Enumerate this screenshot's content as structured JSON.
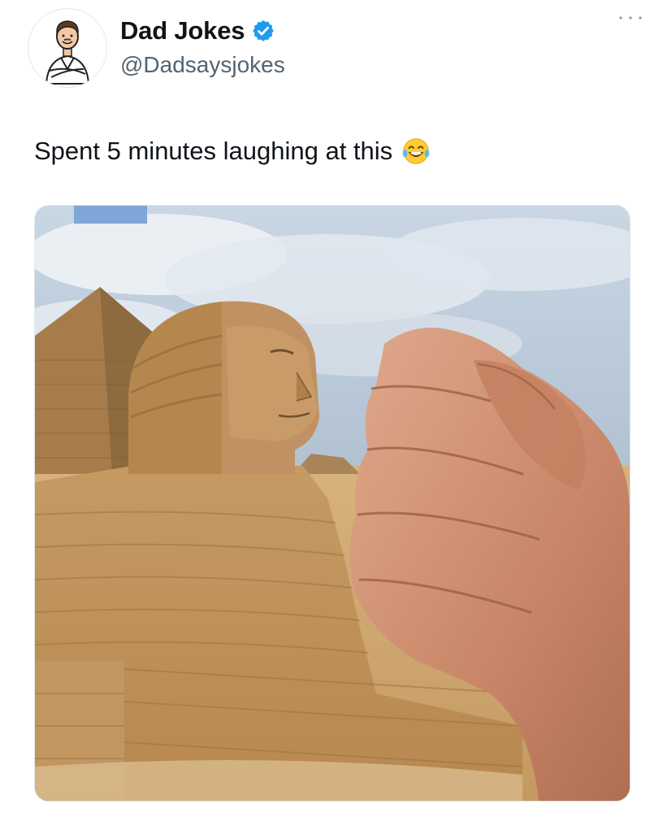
{
  "author": {
    "display_name": "Dad Jokes",
    "handle": "@Dadsaysjokes",
    "verified": true,
    "avatar_icon": "cartoon-dad-avatar-icon"
  },
  "tweet": {
    "text": "Spent 5 minutes laughing at this",
    "emoji": "😂"
  },
  "media": {
    "subject": "Great Sphinx of Giza with pyramid and a hand held up in the foreground"
  },
  "colors": {
    "verified_badge": "#1d9bf0",
    "handle": "#536471",
    "sky": "#b9c9d9",
    "sand": "#c89d65"
  }
}
